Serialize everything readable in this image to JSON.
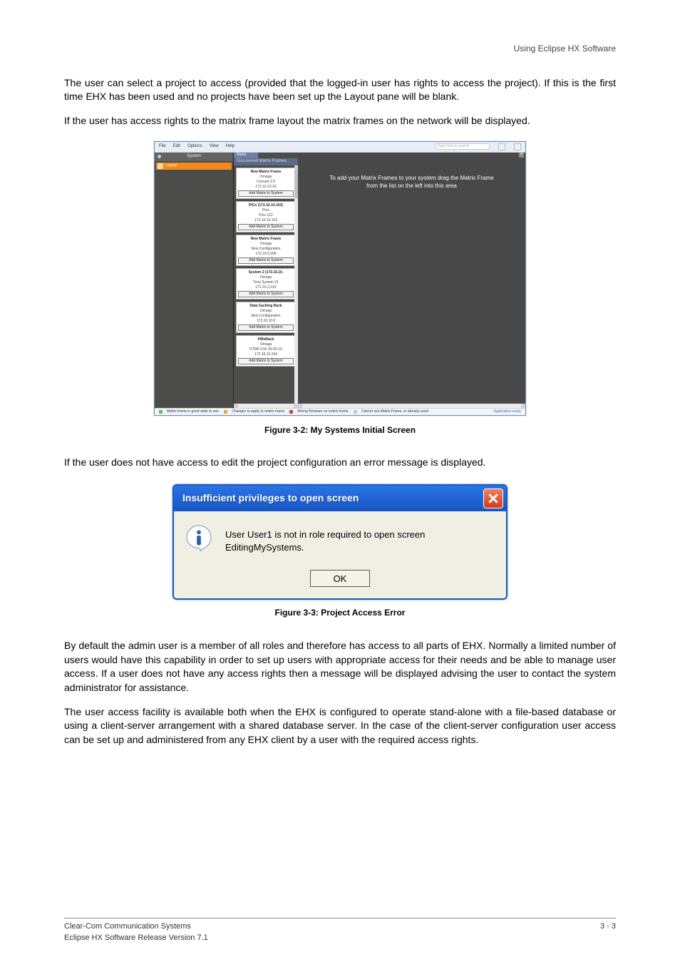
{
  "header": {
    "runningTitle": "Using Eclipse HX Software"
  },
  "paragraphs": {
    "p1": "The user can select a project to access (provided that the logged-in user has rights to access the project). If this is the first time EHX has been used and no projects have been set up the Layout pane will be blank.",
    "p2": "If the user has access rights to the matrix frame layout the matrix frames on the network will be displayed.",
    "p3": "If the user does not have access to edit the project configuration an error message is displayed.",
    "p4": "By default the admin user is a member of all roles and therefore has access to all parts of EHX. Normally a limited number of users would have this capability in order to set up users with appropriate access for their needs and be able to manage user access. If a user does not have any access rights then a message will be displayed advising the user to contact the system administrator for assistance.",
    "p5": "The user access facility is available both when the EHX is configured to operate stand-alone with a file-based database or using a client-server arrangement with a shared database server. In the case of the client-server configuration user access can be set up and administered from any EHX client by a user with the required access rights."
  },
  "app": {
    "menu": [
      "File",
      "Edit",
      "Options",
      "View",
      "Help"
    ],
    "searchPlaceholder": "Type here to search",
    "left": {
      "systemLabel": "System",
      "navItem": "Layout"
    },
    "mid": {
      "nameTab": "Name",
      "discovered": "Discovered Matrix Frames",
      "addBtn": "Add Matrix to System",
      "frames": [
        {
          "title": "New Matrix Frame",
          "l1": "Omega",
          "l2": "Convert 2.5",
          "l3": "172.16.10.10"
        },
        {
          "title": "PiCo (172.16.10.103)",
          "l1": "Pico",
          "l2": "Pico 122",
          "l3": "172.16.10.103"
        },
        {
          "title": "New Matrix Frame",
          "l1": "Omega",
          "l2": "New Configuration",
          "l3": "172.16.0.206"
        },
        {
          "title": "System 2 (172.16.10.",
          "l1": "Omega",
          "l2": "Tony System 21",
          "l3": "172.16.2.210"
        },
        {
          "title": "Data Caching Rack",
          "l1": "Omega",
          "l2": "New Configuration",
          "l3": "172.16.10.6"
        },
        {
          "title": "KMsRack",
          "l1": "Omega",
          "l2": "DTMF+Chi 25-05-10",
          "l3": "172.16.10.244"
        }
      ]
    },
    "rightMsg": "To add your Matrix Frames to your system drag the Matrix Frame from the list on the left into this area",
    "status": {
      "s1": "Matrix frame in good state to use.",
      "s2": "Changes to apply to matrix frame.",
      "s3": "Wrong firmware on matrix frame.",
      "s4": "Cannot use Matrix Frame, or already used.",
      "ready": "Application ready"
    }
  },
  "figCaption": "Figure 3-2: My Systems Initial Screen",
  "dialog": {
    "title": "Insufficient privileges to open screen",
    "message": "User User1 is not in role required to open screen EditingMySystems.",
    "ok": "OK"
  },
  "dlgCaption": "Figure 3-3: Project Access Error",
  "footer": {
    "left": "Clear-Com Communication Systems",
    "center": "Eclipse HX Software Release Version 7.1",
    "right": "3 - 3"
  }
}
